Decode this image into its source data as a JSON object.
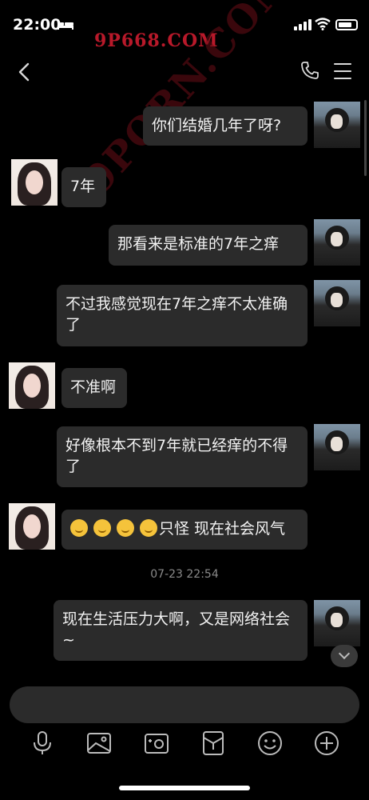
{
  "status_bar": {
    "time": "22:00"
  },
  "watermarks": {
    "top": "9P668.COM",
    "diagonal": "9PORN.COM"
  },
  "messages": [
    {
      "from": "me",
      "text": "你们结婚几年了呀?"
    },
    {
      "from": "her",
      "text": "7年"
    },
    {
      "from": "me",
      "text": "那看来是标准的7年之痒"
    },
    {
      "from": "me",
      "text": "不过我感觉现在7年之痒不太准确了"
    },
    {
      "from": "her",
      "text": "不准啊"
    },
    {
      "from": "me",
      "text": "好像根本不到7年就已经痒的不得了"
    },
    {
      "from": "her",
      "text": "只怪 现在社会风气",
      "emoji_count": 4
    },
    {
      "from": "me",
      "text": "现在生活压力大啊，又是网络社会~"
    }
  ],
  "timestamp": "07-23 22:54",
  "toolbar_icons": [
    "microphone-icon",
    "photo-icon",
    "camera-icon",
    "red-packet-icon",
    "emoji-icon",
    "plus-icon"
  ]
}
